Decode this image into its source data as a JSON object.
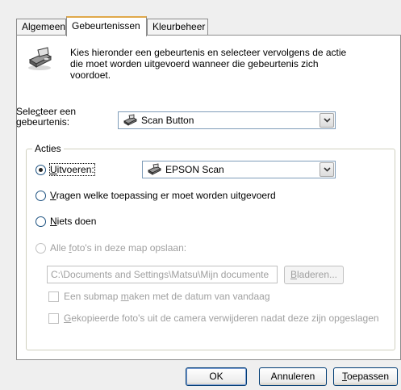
{
  "tabs": [
    {
      "label": "Algemeen"
    },
    {
      "label": "Gebeurtenissen"
    },
    {
      "label": "Kleurbeheer"
    }
  ],
  "intro": {
    "icon": "scanner-icon",
    "text_line1": "Kies hieronder een gebeurtenis en selecteer vervolgens de actie",
    "text_line2": "die moet worden uitgevoerd wanneer die gebeurtenis zich",
    "text_line3": "voordoet."
  },
  "event": {
    "label_pre": "Sele",
    "label_key": "c",
    "label_post": "teer een",
    "label_line2": "gebeurtenis:",
    "value": "Scan Button",
    "icon": "scanner-icon"
  },
  "actions": {
    "group_label": "Acties",
    "run": {
      "key": "U",
      "label_rest": "itvoeren:",
      "checked": true,
      "program": "EPSON Scan",
      "program_icon": "scanner-icon"
    },
    "ask": {
      "key": "V",
      "label_rest": "ragen welke toepassing er moet worden uitgevoerd"
    },
    "nothing": {
      "key": "N",
      "label_rest": "iets doen"
    },
    "save": {
      "label_pre": "Alle ",
      "key": "f",
      "label_rest": "oto's in deze map opslaan:",
      "folder": "C:\\Documents and Settings\\Matsu\\Mijn documente",
      "browse_key": "B",
      "browse_rest": "laderen...",
      "subfolder_pre": "Een submap ",
      "subfolder_key": "m",
      "subfolder_rest": "aken met de datum van vandaag",
      "delete_key": "G",
      "delete_rest": "ekopieerde foto's uit de camera verwijderen nadat deze zijn opgeslagen"
    }
  },
  "buttons": {
    "ok": "OK",
    "cancel": "Annuleren",
    "apply_key": "T",
    "apply_rest": "oepassen"
  }
}
